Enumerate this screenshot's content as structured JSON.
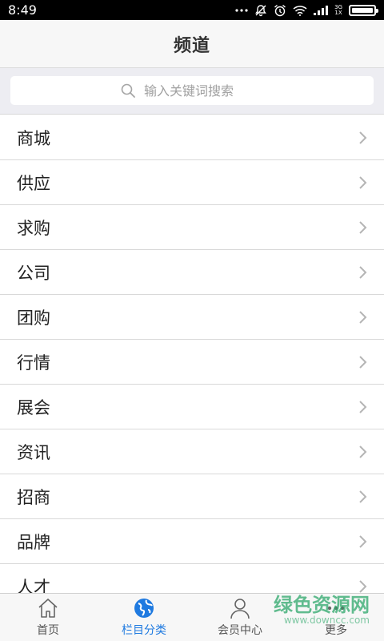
{
  "status_bar": {
    "time": "8:49",
    "network_top": "3G",
    "network_bottom": "1X"
  },
  "header": {
    "title": "频道"
  },
  "search": {
    "placeholder": "输入关键词搜索"
  },
  "channels": [
    {
      "label": "商城"
    },
    {
      "label": "供应"
    },
    {
      "label": "求购"
    },
    {
      "label": "公司"
    },
    {
      "label": "团购"
    },
    {
      "label": "行情"
    },
    {
      "label": "展会"
    },
    {
      "label": "资讯"
    },
    {
      "label": "招商"
    },
    {
      "label": "品牌"
    },
    {
      "label": "人才"
    }
  ],
  "tabs": [
    {
      "label": "首页",
      "icon": "home-icon",
      "active": false
    },
    {
      "label": "栏目分类",
      "icon": "globe-icon",
      "active": true
    },
    {
      "label": "会员中心",
      "icon": "user-icon",
      "active": false
    },
    {
      "label": "更多",
      "icon": "more-icon",
      "active": false
    }
  ],
  "watermark": {
    "main": "绿色资源网",
    "sub": "www.downcc.com"
  },
  "colors": {
    "accent": "#1f7ae0",
    "watermark": "#2ea86b",
    "header_bg": "#f7f7f7",
    "search_bg": "#ededf2"
  }
}
